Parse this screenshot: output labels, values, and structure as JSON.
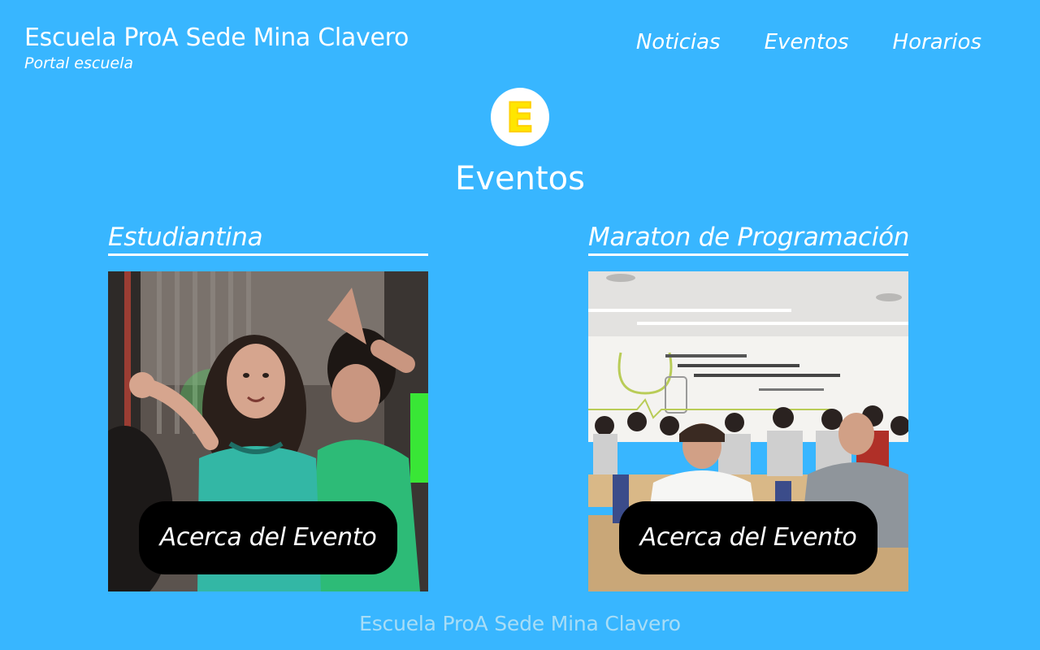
{
  "colors": {
    "background": "#38b6ff",
    "text": "#ffffff",
    "button": "#000000",
    "logo_letter": "#ffe600",
    "footer_text": "#a8ddf6"
  },
  "header": {
    "title": "Escuela ProA Sede Mina Clavero",
    "subtitle": "Portal escuela"
  },
  "nav": {
    "items": [
      {
        "label": "Noticias"
      },
      {
        "label": "Eventos"
      },
      {
        "label": "Horarios"
      }
    ]
  },
  "logo": {
    "letter": "E",
    "icon": "yellow-e-icon"
  },
  "section": {
    "title": "Eventos"
  },
  "events": [
    {
      "title": "Estudiantina",
      "button_label": "Acerca del Evento",
      "image": "students-dancing-photo"
    },
    {
      "title": "Maraton de Programación",
      "button_label": "Acerca del Evento",
      "image": "students-classroom-photo"
    }
  ],
  "footer": {
    "text": "Escuela ProA Sede Mina Clavero"
  }
}
